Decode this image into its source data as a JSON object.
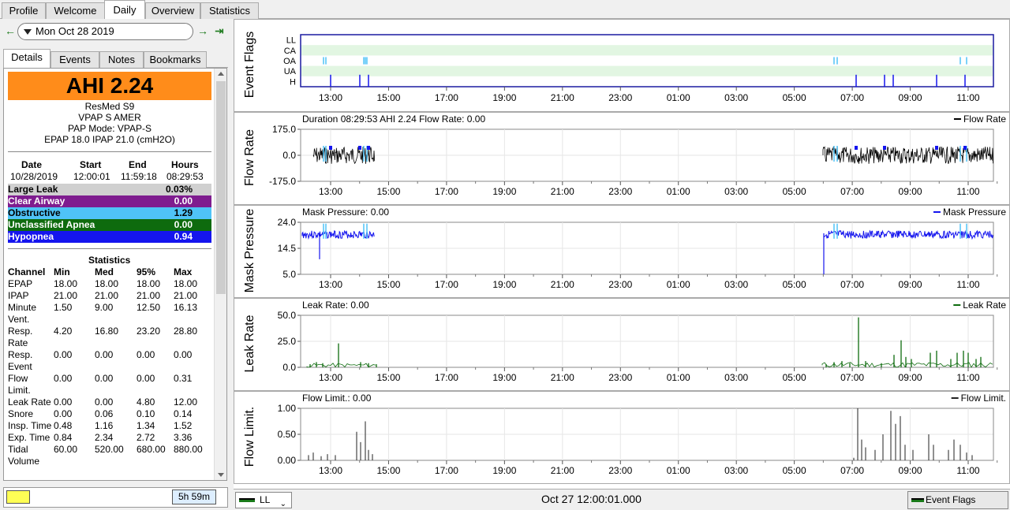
{
  "tabs": [
    "Profile",
    "Welcome",
    "Daily",
    "Overview",
    "Statistics"
  ],
  "date": "Mon Oct 28 2019",
  "subtabs": [
    "Details",
    "Events",
    "Notes",
    "Bookmarks"
  ],
  "ahi": "AHI 2.24",
  "device": [
    "ResMed S9",
    "VPAP S AMER",
    "PAP Mode: VPAP-S",
    "EPAP 18.0 IPAP 21.0 (cmH2O)"
  ],
  "session": {
    "headers": [
      "Date",
      "Start",
      "End",
      "Hours"
    ],
    "values": [
      "10/28/2019",
      "12:00:01",
      "11:59:18",
      "08:29:53"
    ]
  },
  "events": [
    {
      "label": "Large Leak",
      "value": "0.03%",
      "color": "#d0d0d0",
      "text": "#000000"
    },
    {
      "label": "Clear Airway",
      "value": "0.00",
      "color": "#7f1c8f",
      "text": "#ffffff"
    },
    {
      "label": "Obstructive",
      "value": "1.29",
      "color": "#4fc3f7",
      "text": "#000000"
    },
    {
      "label": "Unclassified Apnea",
      "value": "0.00",
      "color": "#0e6b0e",
      "text": "#ffffff"
    },
    {
      "label": "Hypopnea",
      "value": "0.94",
      "color": "#1515ee",
      "text": "#ffffff"
    }
  ],
  "stats": {
    "title": "Statistics",
    "headers": [
      "Channel",
      "Min",
      "Med",
      "95%",
      "Max"
    ],
    "rows": [
      {
        "name": "EPAP",
        "name2": "",
        "min": "18.00",
        "med": "18.00",
        "p95": "18.00",
        "max": "18.00"
      },
      {
        "name": "IPAP",
        "name2": "",
        "min": "21.00",
        "med": "21.00",
        "p95": "21.00",
        "max": "21.00"
      },
      {
        "name": "Minute",
        "name2": "Vent.",
        "min": "1.50",
        "med": "9.00",
        "p95": "12.50",
        "max": "16.13"
      },
      {
        "name": "Resp.",
        "name2": "Rate",
        "min": "4.20",
        "med": "16.80",
        "p95": "23.20",
        "max": "28.80"
      },
      {
        "name": "Resp.",
        "name2": "Event",
        "min": "0.00",
        "med": "0.00",
        "p95": "0.00",
        "max": "0.00"
      },
      {
        "name": "Flow",
        "name2": "Limit.",
        "min": "0.00",
        "med": "0.00",
        "p95": "0.00",
        "max": "0.31"
      },
      {
        "name": "Leak Rate",
        "name2": "",
        "min": "0.00",
        "med": "0.00",
        "p95": "4.80",
        "max": "12.00"
      },
      {
        "name": "Snore",
        "name2": "",
        "min": "0.00",
        "med": "0.06",
        "p95": "0.10",
        "max": "0.14"
      },
      {
        "name": "Insp. Time",
        "name2": "",
        "min": "0.48",
        "med": "1.16",
        "p95": "1.34",
        "max": "1.52"
      },
      {
        "name": "Exp. Time",
        "name2": "",
        "min": "0.84",
        "med": "2.34",
        "p95": "2.72",
        "max": "3.36"
      },
      {
        "name": "Tidal",
        "name2": "Volume",
        "min": "60.00",
        "med": "520.00",
        "p95": "680.00",
        "max": "880.00"
      }
    ]
  },
  "duration_short": "5h 59m",
  "time_ticks": [
    "13:00",
    "15:00",
    "17:00",
    "19:00",
    "21:00",
    "23:00",
    "01:00",
    "03:00",
    "05:00",
    "07:00",
    "09:00",
    "11:00"
  ],
  "graphs": {
    "event_flags": {
      "title": "Event Flags",
      "rows": [
        "LL",
        "CA",
        "OA",
        "UA",
        "H"
      ]
    },
    "flow_rate": {
      "title": "Flow Rate",
      "header": "Duration 08:29:53 AHI 2.24 Flow Rate: 0.00",
      "legend": "Flow Rate",
      "yticks": [
        "175.0",
        "0.0",
        "-175.0"
      ]
    },
    "mask_pressure": {
      "title": "Mask Pressure",
      "header": "Mask Pressure: 0.00",
      "legend": "Mask Pressure",
      "yticks": [
        "24.0",
        "14.5",
        "5.0"
      ]
    },
    "leak_rate": {
      "title": "Leak Rate",
      "header": "Leak Rate: 0.00",
      "legend": "Leak Rate",
      "yticks": [
        "50.0",
        "25.0",
        "0.0"
      ]
    },
    "flow_limit": {
      "title": "Flow Limit.",
      "header": "Flow Limit.: 0.00",
      "legend": "Flow Limit.",
      "yticks": [
        "1.00",
        "0.50",
        "0.00"
      ]
    }
  },
  "footer": {
    "select": "LL",
    "time": "Oct 27 12:00:01.000",
    "button": "Event Flags"
  },
  "colors": {
    "ahi": "#ff8c1a",
    "flow": "#000000",
    "pressure": "#1515ee",
    "leak": "#0e6b0e",
    "flowlimit": "#222222",
    "oa": "#4fc3f7",
    "h": "#1515ee"
  }
}
